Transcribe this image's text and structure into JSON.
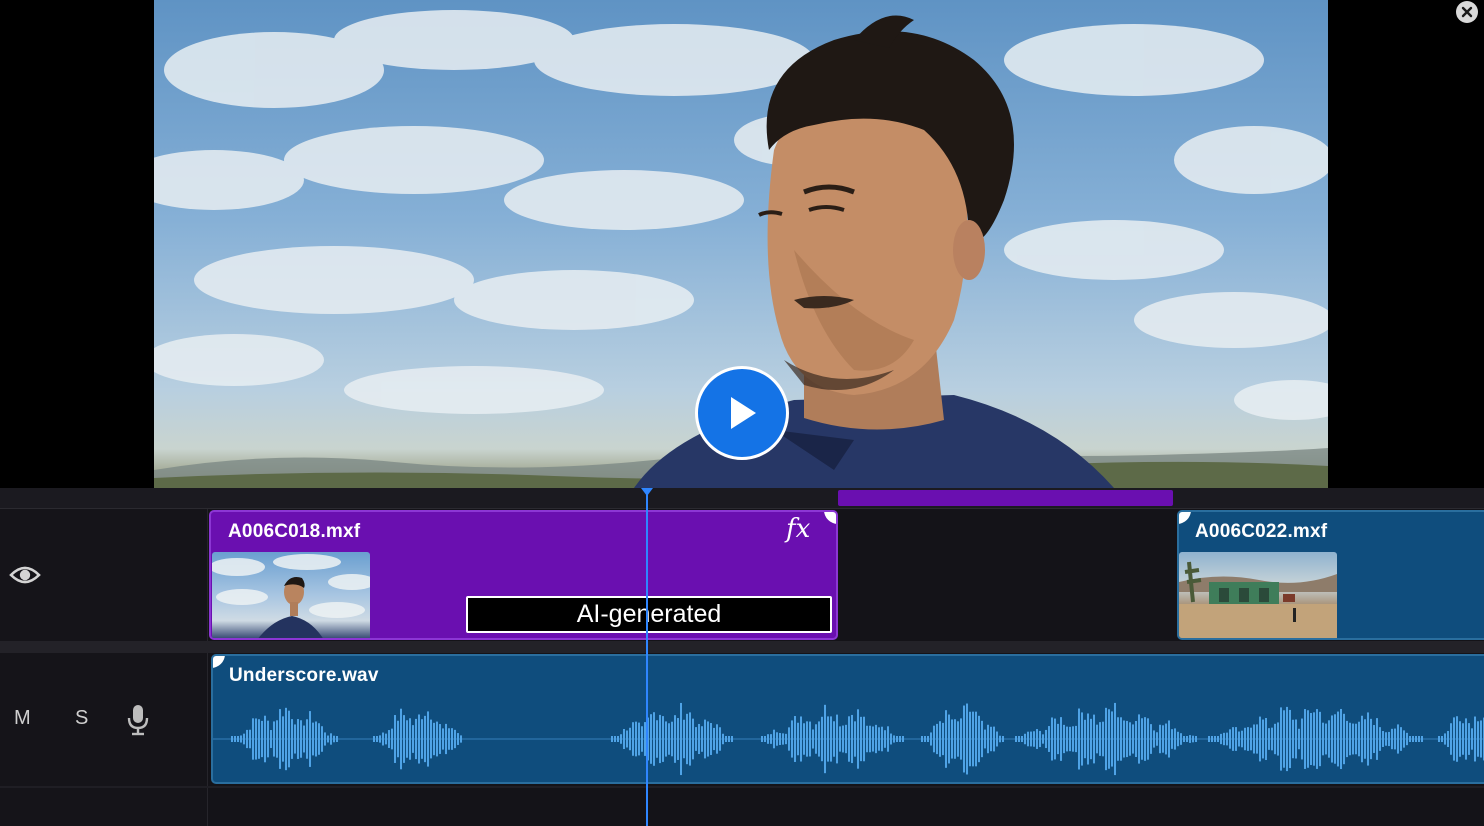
{
  "viewer": {
    "play_icon": "play-icon",
    "close_icon": "close-icon"
  },
  "timeline": {
    "video_track": {
      "visibility_icon": "eye-icon",
      "clips": [
        {
          "name": "A006C018.mxf",
          "effect_badge": "fx",
          "label": "AI-generated",
          "color": "#6a0fb0"
        },
        {
          "name": "A006C022.mxf",
          "color": "#0f4d7d"
        }
      ]
    },
    "audio_track": {
      "mute_label": "M",
      "solo_label": "S",
      "mic_icon": "microphone-icon",
      "clips": [
        {
          "name": "Underscore.wav",
          "color": "#0f4d7d"
        }
      ]
    }
  },
  "colors": {
    "accent": "#1473e6",
    "playhead": "#2f86ff",
    "waveform": "#4fa3e6",
    "ai_clip": "#6a0fb0",
    "media_clip": "#0f4d7d"
  }
}
